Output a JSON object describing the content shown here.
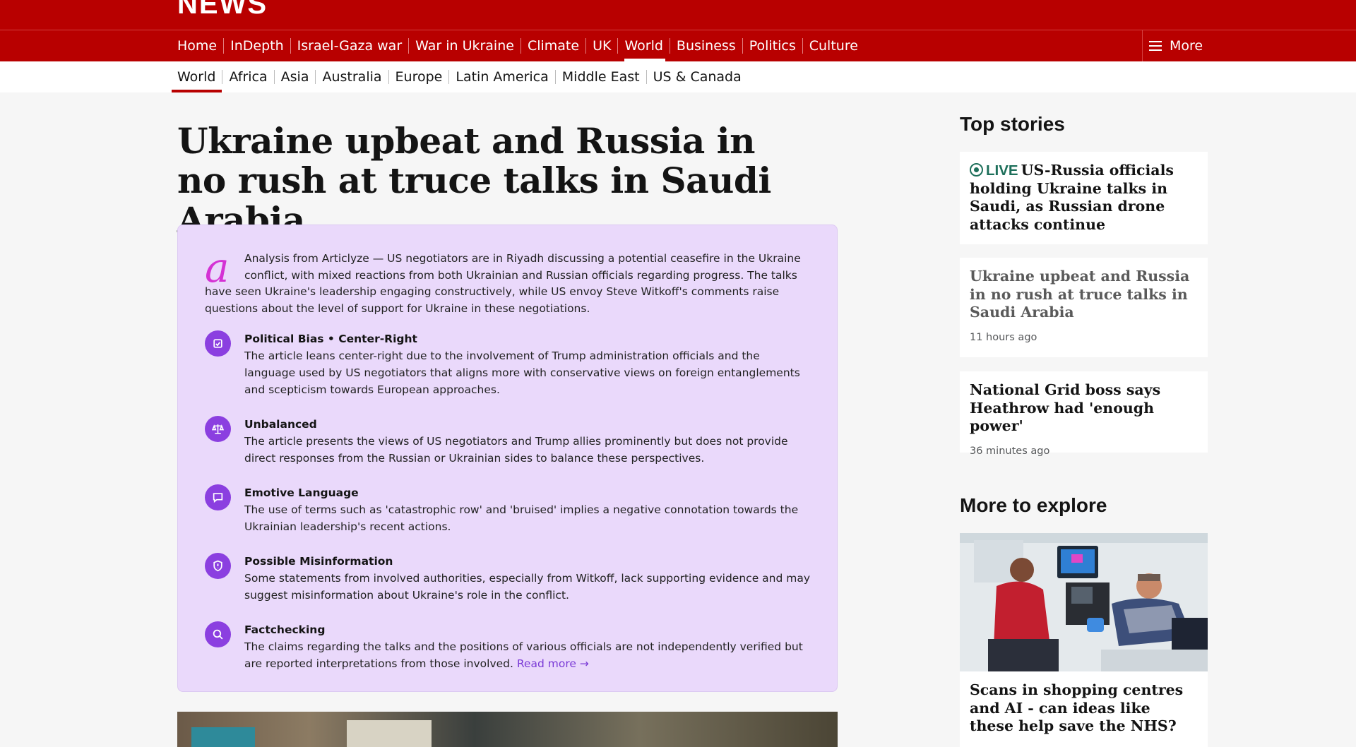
{
  "masthead": {
    "logo_text": "NEWS"
  },
  "nav": {
    "items": [
      {
        "label": "Home"
      },
      {
        "label": "InDepth"
      },
      {
        "label": "Israel-Gaza war"
      },
      {
        "label": "War in Ukraine"
      },
      {
        "label": "Climate"
      },
      {
        "label": "UK"
      },
      {
        "label": "World",
        "active": true
      },
      {
        "label": "Business"
      },
      {
        "label": "Politics"
      },
      {
        "label": "Culture"
      }
    ],
    "more_label": "More",
    "more_icon": "hamburger-icon",
    "background": "#b80000"
  },
  "subnav": {
    "items": [
      {
        "label": "World",
        "active": true
      },
      {
        "label": "Africa"
      },
      {
        "label": "Asia"
      },
      {
        "label": "Australia"
      },
      {
        "label": "Europe"
      },
      {
        "label": "Latin America"
      },
      {
        "label": "Middle East"
      },
      {
        "label": "US & Canada"
      }
    ]
  },
  "article": {
    "headline": "Ukraine upbeat and Russia in no rush at truce talks in Saudi Arabia"
  },
  "analysis": {
    "logo_letter": "a",
    "intro": "Analysis from Articlyze — US negotiators are in Riyadh discussing a potential ceasefire in the Ukraine conflict, with mixed reactions from both Ukrainian and Russian officials regarding progress. The talks have seen Ukraine's leadership engaging constructively, while US envoy Steve Witkoff's comments raise questions about the level of support for Ukraine in these negotiations.",
    "accent_color": "#8b3fe0",
    "items": [
      {
        "icon": "bias-icon",
        "title": "Political Bias • Center-Right",
        "desc": "The article leans center-right due to the involvement of Trump administration officials and the language used by US negotiators that aligns more with conservative views on foreign entanglements and scepticism towards European approaches."
      },
      {
        "icon": "scale-icon",
        "title": "Unbalanced",
        "desc": "The article presents the views of US negotiators and Trump allies prominently but does not provide direct responses from the Russian or Ukrainian sides to balance these perspectives."
      },
      {
        "icon": "speech-bubble-icon",
        "title": "Emotive Language",
        "desc": "The use of terms such as 'catastrophic row' and 'bruised' implies a negative connotation towards the Ukrainian leadership's recent actions."
      },
      {
        "icon": "shield-alert-icon",
        "title": "Possible Misinformation",
        "desc": "Some statements from involved authorities, especially from Witkoff, lack supporting evidence and may suggest misinformation about Ukraine's role in the conflict."
      },
      {
        "icon": "magnifier-icon",
        "title": "Factchecking",
        "desc": "The claims regarding the talks and the positions of various officials are not independently verified but are reported interpretations from those involved."
      }
    ],
    "read_more": "Read more →"
  },
  "sidebar": {
    "top_stories_title": "Top stories",
    "stories": [
      {
        "live_label": "LIVE",
        "title": "US-Russia officials holding Ukraine talks in Saudi, as Russian drone attacks continue"
      },
      {
        "title": "Ukraine upbeat and Russia in no rush at truce talks in Saudi Arabia",
        "time": "11 hours ago"
      },
      {
        "title": "National Grid boss says Heathrow had 'enough power'",
        "time": "36 minutes ago"
      }
    ],
    "explore_title": "More to explore",
    "explore": [
      {
        "title": "Scans in shopping centres and AI - can ideas like these help save the NHS?"
      }
    ]
  }
}
